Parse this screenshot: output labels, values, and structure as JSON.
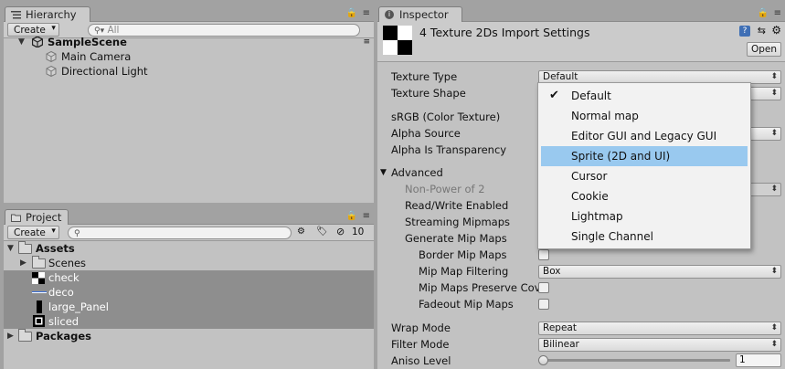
{
  "hierarchy": {
    "tab_label": "Hierarchy",
    "create_label": "Create",
    "search_placeholder": "All",
    "scene_name": "SampleScene",
    "objects": [
      "Main Camera",
      "Directional Light"
    ]
  },
  "project": {
    "tab_label": "Project",
    "create_label": "Create",
    "hidden_count": "10",
    "tree": {
      "assets": "Assets",
      "scenes": "Scenes",
      "files": [
        "check",
        "deco",
        "large_Panel",
        "sliced"
      ],
      "packages": "Packages"
    }
  },
  "inspector": {
    "tab_label": "Inspector",
    "title": "4 Texture 2Ds Import Settings",
    "open_label": "Open",
    "labels": {
      "texture_type": "Texture Type",
      "texture_shape": "Texture Shape",
      "srgb": "sRGB (Color Texture)",
      "alpha_source": "Alpha Source",
      "alpha_transparency": "Alpha Is Transparency",
      "advanced": "Advanced",
      "non_power": "Non-Power of 2",
      "read_write": "Read/Write Enabled",
      "streaming": "Streaming Mipmaps",
      "gen_mip": "Generate Mip Maps",
      "border_mip": "Border Mip Maps",
      "mip_filter": "Mip Map Filtering",
      "mip_preserve": "Mip Maps Preserve Cov",
      "fadeout": "Fadeout Mip Maps",
      "wrap": "Wrap Mode",
      "filter": "Filter Mode",
      "aniso": "Aniso Level"
    },
    "values": {
      "texture_type": "Default",
      "mip_filter": "Box",
      "wrap": "Repeat",
      "filter": "Bilinear",
      "aniso": "1"
    },
    "aniso_slider_fraction": 0.0
  },
  "texture_type_menu": {
    "items": [
      "Default",
      "Normal map",
      "Editor GUI and Legacy GUI",
      "Sprite (2D and UI)",
      "Cursor",
      "Cookie",
      "Lightmap",
      "Single Channel"
    ],
    "checked": "Default",
    "highlighted": "Sprite (2D and UI)"
  }
}
